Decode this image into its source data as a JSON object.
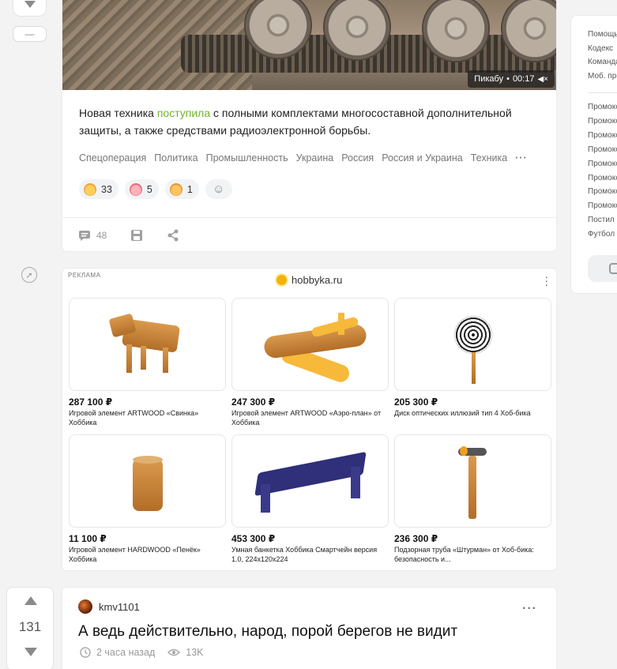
{
  "post1": {
    "video_source": "Пикабу",
    "video_time": "00:17",
    "text_before": "Новая техника ",
    "text_link": "поступила",
    "text_after": " с полными комплектами многосоставной дополнительной защиты, а также средствами радиоэлектронной борьбы.",
    "tags": [
      "Спецоперация",
      "Политика",
      "Промышленность",
      "Украина",
      "Россия",
      "Россия и Украина",
      "Техника"
    ],
    "tags_more": "···",
    "reactions": [
      {
        "icon": "laughing-emoji-icon",
        "count": "33"
      },
      {
        "icon": "pig-emoji-icon",
        "count": "5"
      },
      {
        "icon": "grin-emoji-icon",
        "count": "1"
      }
    ],
    "comments_count": "48"
  },
  "ad": {
    "label": "РЕКЛАМА",
    "domain": "hobbyka.ru",
    "products": [
      {
        "price": "287 100 ₽",
        "desc": "Игровой элемент ARTWOOD «Свинка» Хоббика",
        "icon": "wooden-pig-image"
      },
      {
        "price": "247 300 ₽",
        "desc": "Игровой элемент ARTWOOD «Аэро-план» от Хоббика",
        "icon": "wooden-airplane-image"
      },
      {
        "price": "205 300 ₽",
        "desc": "Диск оптических иллюзий тип 4 Хоб-бика",
        "icon": "illusion-disc-image"
      },
      {
        "price": "11 100 ₽",
        "desc": "Игровой элемент HARDWOOD «Пенёк» Хоббика",
        "icon": "wooden-stump-image"
      },
      {
        "price": "453 300 ₽",
        "desc": "Умная банкетка Хоббика Смартчейн версия 1.0, 224x120x224",
        "icon": "smart-bench-image"
      },
      {
        "price": "236 300 ₽",
        "desc": "Подзорная труба «Штурман» от Хоб-бика: безопасность и...",
        "icon": "spyglass-image"
      }
    ]
  },
  "post2": {
    "rating": "131",
    "author": "kmv1101",
    "title": "А ведь действительно, народ, порой берегов не видит",
    "time_ago": "2 часа назад",
    "views": "13K"
  },
  "sidebar": {
    "links_top": [
      "Помощь",
      "Кодекс",
      "Команда",
      "Моб. приложение"
    ],
    "links_bottom": [
      "Промокоды",
      "Промокоды",
      "Промокоды",
      "Промокоды",
      "Промокоды",
      "Промокоды",
      "Промокоды",
      "Промокоды",
      "Постил",
      "Футбол"
    ]
  },
  "colors": {
    "accent_green": "#6fb52c",
    "background": "#f3f3f4"
  }
}
